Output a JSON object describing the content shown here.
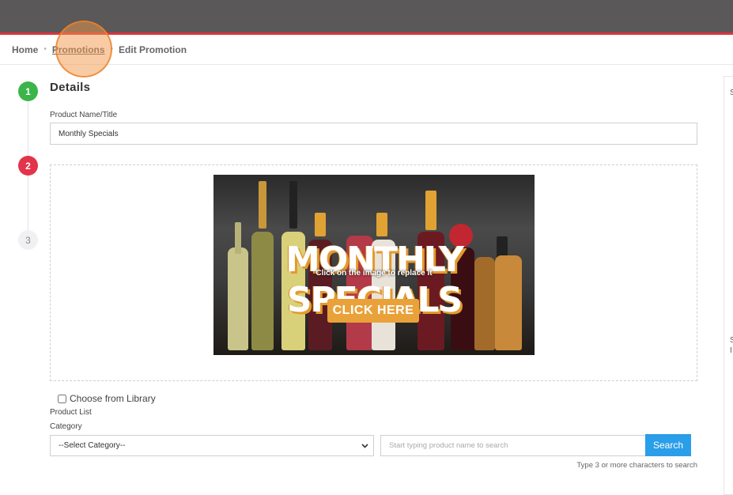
{
  "breadcrumb": {
    "home": "Home",
    "promotions": "Promotions",
    "current": "Edit Promotion",
    "separator": "•"
  },
  "steps": [
    {
      "number": "1",
      "status": "complete",
      "color": "#3bb54a"
    },
    {
      "number": "2",
      "status": "active",
      "color": "#e2344b"
    },
    {
      "number": "3",
      "status": "pending",
      "color": "#f1f1f4"
    }
  ],
  "details": {
    "title": "Details",
    "product_name_label": "Product Name/Title",
    "product_name_value": "Monthly Specials"
  },
  "image": {
    "promo_title": "MONTHLY SPECIALS",
    "overlay_hint": "Click on the image to replace it",
    "cta_label": "CLICK HERE",
    "accent": "#e9a23a"
  },
  "library": {
    "choose_label": "Choose from Library"
  },
  "product_list": {
    "label": "Product List",
    "category_label": "Category",
    "category_selected": "--Select Category--",
    "search_placeholder": "Start typing product name to search",
    "search_button": "Search",
    "search_hint": "Type 3 or more characters to search"
  },
  "side_panel": {
    "chars": [
      "S",
      "S",
      "I"
    ]
  },
  "colors": {
    "topbar": "#5a5859",
    "topbar_accent": "#d9343f",
    "search_button": "#2a9ee8"
  }
}
